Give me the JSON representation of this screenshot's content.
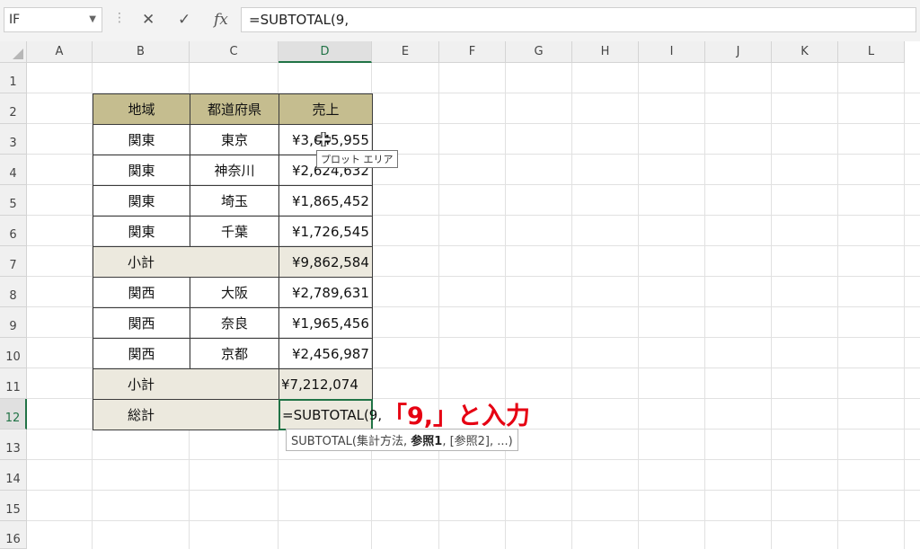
{
  "formula_bar": {
    "name_box": "IF",
    "cancel_icon": "✕",
    "enter_icon": "✓",
    "fx_label": "fx",
    "formula": "=SUBTOTAL(9,"
  },
  "columns": [
    "A",
    "B",
    "C",
    "D",
    "E",
    "F",
    "G",
    "H",
    "I",
    "J",
    "K",
    "L"
  ],
  "active_column": "D",
  "rows": [
    "1",
    "2",
    "3",
    "4",
    "5",
    "6",
    "7",
    "8",
    "9",
    "10",
    "11",
    "12",
    "13",
    "14",
    "15",
    "16"
  ],
  "active_row": "12",
  "table": {
    "headers": [
      "地域",
      "都道府県",
      "売上"
    ],
    "data": [
      {
        "region": "関東",
        "pref": "東京",
        "sales": "¥3,645,955"
      },
      {
        "region": "関東",
        "pref": "神奈川",
        "sales": "¥2,624,632"
      },
      {
        "region": "関東",
        "pref": "埼玉",
        "sales": "¥1,865,452"
      },
      {
        "region": "関東",
        "pref": "千葉",
        "sales": "¥1,726,545"
      },
      {
        "label": "小計",
        "sales": "¥9,862,584"
      },
      {
        "region": "関西",
        "pref": "大阪",
        "sales": "¥2,789,631"
      },
      {
        "region": "関西",
        "pref": "奈良",
        "sales": "¥1,965,456"
      },
      {
        "region": "関西",
        "pref": "京都",
        "sales": "¥2,456,987"
      },
      {
        "label": "小計",
        "sales": "¥7,212,074"
      },
      {
        "label": "総計",
        "sales": "=SUBTOTAL(9,"
      }
    ]
  },
  "tooltip": "プロット エリア",
  "function_hint": {
    "prefix": "SUBTOTAL(集計方法, ",
    "bold": "参照1",
    "suffix": ", [参照2], ...)"
  },
  "annotation": "「9,」と入力",
  "colors": {
    "header_fill": "#c5bd8f",
    "subtotal_fill": "#ece9de",
    "annotation": "#e60012",
    "active": "#217346"
  }
}
